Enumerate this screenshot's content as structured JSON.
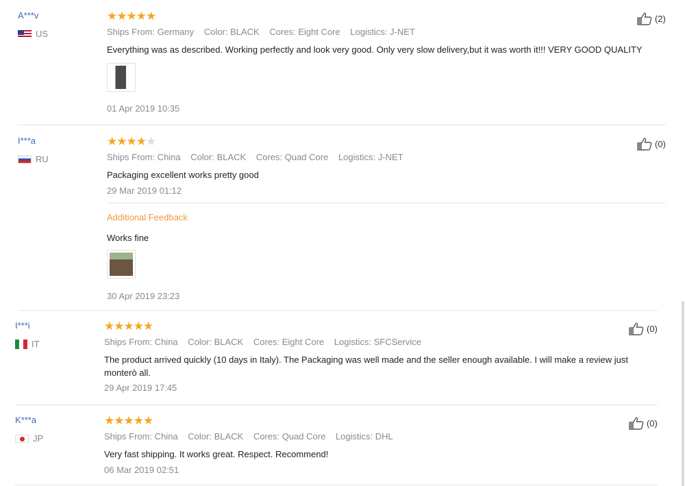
{
  "reviews": [
    {
      "user": "A***v",
      "country": "US",
      "rating": 5,
      "ships_from": "Ships From: Germany",
      "color": "Color: BLACK",
      "cores": "Cores: Eight Core",
      "logistics": "Logistics: J-NET",
      "text": "Everything was as described. Working perfectly and look very good. Only very slow delivery,but it was worth it!!! VERY GOOD QUALITY",
      "date": "01 Apr 2019 10:35",
      "likes": "(2)"
    },
    {
      "user": "I***a",
      "country": "RU",
      "rating": 4,
      "ships_from": "Ships From: China",
      "color": "Color: BLACK",
      "cores": "Cores: Quad Core",
      "logistics": "Logistics: J-NET",
      "text": "Packaging excellent works pretty good",
      "date": "29 Mar 2019 01:12",
      "likes": "(0)",
      "additional": {
        "label": "Additional Feedback",
        "text": "Works fine",
        "date": "30 Apr 2019 23:23"
      }
    },
    {
      "user": "I***i",
      "country": "IT",
      "rating": 5,
      "ships_from": "Ships From: China",
      "color": "Color: BLACK",
      "cores": "Cores: Eight Core",
      "logistics": "Logistics: SFCService",
      "text_line1": "The product arrived quickly (10 days in Italy). The Packaging was well made and the seller enough available. I will make a review just",
      "text_line2": "monterò all.",
      "date": "29 Apr 2019 17:45",
      "likes": "(0)"
    },
    {
      "user": "K***a",
      "country": "JP",
      "rating": 5,
      "ships_from": "Ships From: China",
      "color": "Color: BLACK",
      "cores": "Cores: Quad Core",
      "logistics": "Logistics: DHL",
      "text": "Very fast shipping. It works great. Respect. Recommend!",
      "date": "06 Mar 2019 02:51",
      "likes": "(0)"
    }
  ],
  "colors": {
    "star": "#f5a623",
    "star_off": "#dcdcdc",
    "username": "#3a6bb8",
    "additional": "#f29a3c",
    "meta": "#8a8a8a"
  }
}
